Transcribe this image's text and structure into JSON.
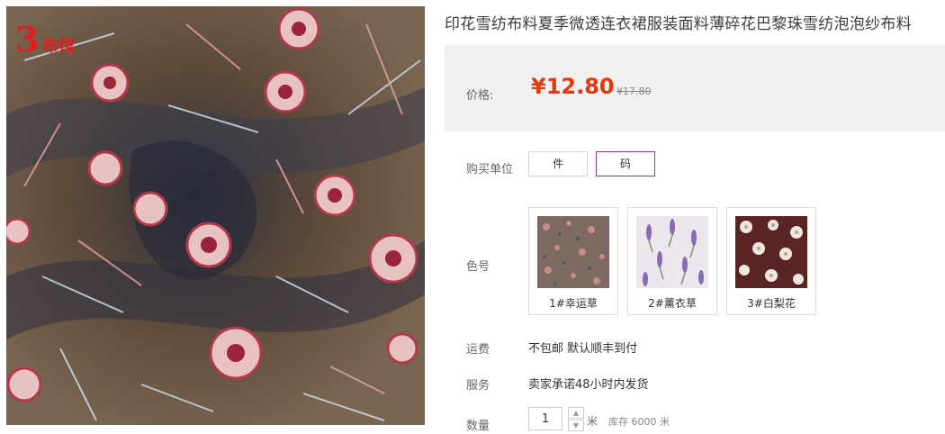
{
  "product": {
    "title": "印花雪纺布料夏季微透连衣裙服装面料薄碎花巴黎珠雪纺泡泡纱布料",
    "logo_text": "3",
    "logo_sub": "布馆"
  },
  "price": {
    "label": "价格:",
    "current": "¥12.80",
    "original": "¥17.80"
  },
  "unit": {
    "label": "购买单位",
    "options": [
      "件",
      "码"
    ],
    "selected": "码"
  },
  "color": {
    "label": "色号",
    "options": [
      {
        "name": "1#幸运草"
      },
      {
        "name": "2#薰衣草"
      },
      {
        "name": "3#白梨花"
      }
    ]
  },
  "shipping": {
    "label": "运费",
    "value": "不包邮 默认顺丰到付"
  },
  "service": {
    "label": "服务",
    "value": "卖家承诺48小时内发货"
  },
  "quantity": {
    "label": "数量",
    "value": "1",
    "unit": "米",
    "stock": "库存 6000 米"
  },
  "colors": {
    "accent": "#e4380b",
    "selected_border": "#8f3d85",
    "price_bg": "#f0f0f0"
  }
}
